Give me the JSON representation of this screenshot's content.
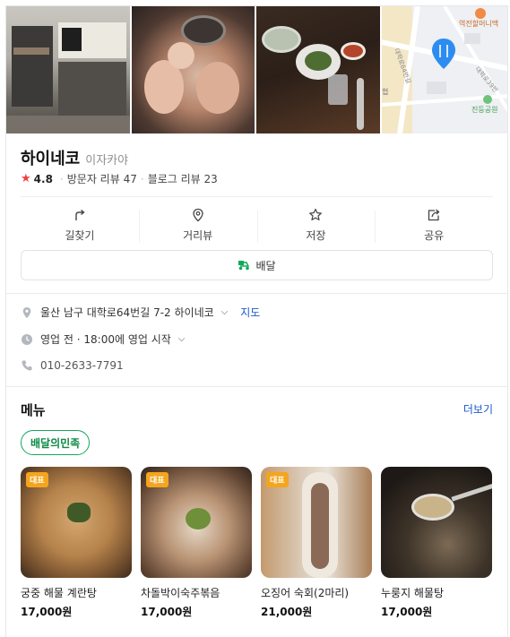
{
  "place": {
    "name": "하이네코",
    "category": "이자카야",
    "rating": "4.8",
    "visitor_reviews": "방문자 리뷰 47",
    "blog_reviews": "블로그 리뷰 23"
  },
  "map": {
    "labels": [
      "역전할머니맥",
      "대학로64번길",
      "대학로39번",
      "진등공원",
      "협"
    ]
  },
  "actions": [
    {
      "label": "길찾기",
      "icon": "directions-icon"
    },
    {
      "label": "거리뷰",
      "icon": "location-pin-icon"
    },
    {
      "label": "저장",
      "icon": "star-icon"
    },
    {
      "label": "공유",
      "icon": "share-icon"
    }
  ],
  "delivery_button": "배달",
  "info": {
    "address": "울산 남구 대학로64번길 7-2 하이네코",
    "map_link": "지도",
    "hours": "영업 전 · 18:00에 영업 시작",
    "phone": "010-2633-7791"
  },
  "menu": {
    "title": "메뉴",
    "more": "더보기",
    "chip": "배달의민족",
    "badge": "대표",
    "items": [
      {
        "name": "궁중 해물 계란탕",
        "price": "17,000원"
      },
      {
        "name": "차돌박이숙주볶음",
        "price": "17,000원"
      },
      {
        "name": "오징어 숙회(2마리)",
        "price": "21,000원"
      },
      {
        "name": "누룽지 해물탕",
        "price": "17,000원"
      }
    ]
  },
  "colors": {
    "accent_blue": "#1a5ac8",
    "rating_star": "#f03e3e",
    "chip_green": "#0fa958",
    "badge_orange": "#f5a51d",
    "map_pin": "#2d8cf0"
  }
}
